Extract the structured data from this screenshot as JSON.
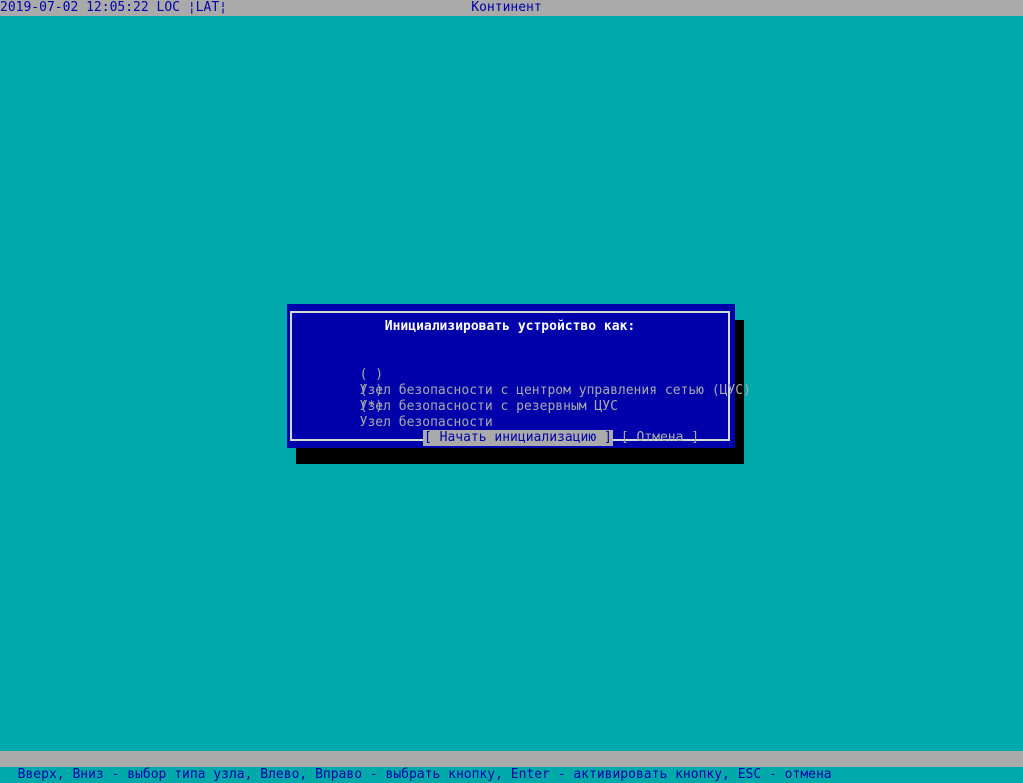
{
  "topbar": {
    "status": "2019-07-02 12:05:22 LOC ¦LAT¦",
    "title": "Континент"
  },
  "dialog": {
    "title": "Инициализировать устройство как:",
    "options": [
      {
        "marker": "( )",
        "label": "Узел безопасности с центром управления сетью (ЦУС)",
        "selected": false
      },
      {
        "marker": "( )",
        "label": "Узел безопасности с резервным ЦУС",
        "selected": false
      },
      {
        "marker": "(*)",
        "label": "Узел безопасности",
        "selected": true
      }
    ],
    "buttons": {
      "start": "[ Начать инициализацию ]",
      "cancel": "[ Отмена ]"
    }
  },
  "bottombar": {
    "hint": "Вверх, Вниз - выбор типа узла, Влево, Вправо - выбрать кнопку, Enter - активировать кнопку, ESC - отмена"
  },
  "colors": {
    "background": "#00aaaa",
    "dialog": "#0000aa",
    "bar": "#aaaaaa"
  }
}
